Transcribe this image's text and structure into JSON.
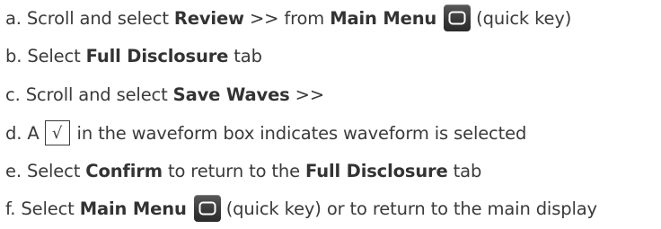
{
  "steps": [
    {
      "marker": "a.",
      "t1": "Scroll and select ",
      "b1": "Review",
      "t2": " >> from ",
      "b2": "Main Menu",
      "icon": "main-menu-key-icon",
      "t3": "(quick key)"
    },
    {
      "marker": "b.",
      "t1": "Select ",
      "b1": "Full Disclosure",
      "t2": " tab"
    },
    {
      "marker": "c.",
      "t1": "Scroll and select ",
      "b1": "Save Waves",
      "t2": " >>"
    },
    {
      "marker": "d.",
      "t1": "A",
      "check": "√",
      "t2": "in the waveform box indicates waveform is selected"
    },
    {
      "marker": "e.",
      "t1": "Select ",
      "b1": "Confirm",
      "t2": " to return to the ",
      "b2": "Full Disclosure",
      "t3": " tab"
    },
    {
      "marker": "f.",
      "t1": "Select ",
      "b1": "Main Menu",
      "icon": "main-menu-key-icon",
      "t2": "(quick key) or to return to the main display"
    }
  ]
}
